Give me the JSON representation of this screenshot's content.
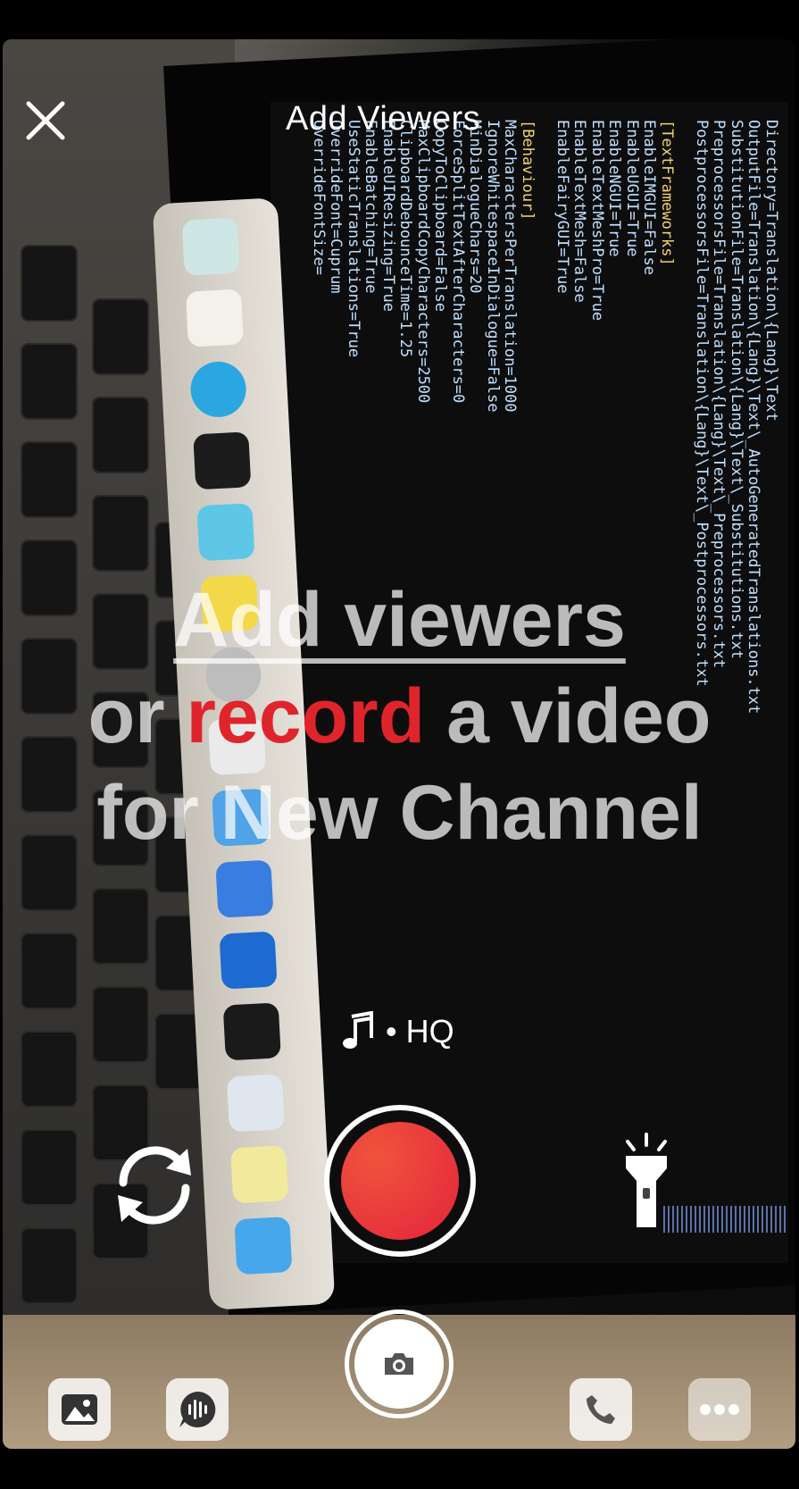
{
  "header": {
    "title": "Add Viewers"
  },
  "prompt": {
    "link_text": "Add viewers",
    "line2_prefix": "or ",
    "line2_accent": "record",
    "line2_suffix": " a video",
    "line3": "for New Channel"
  },
  "status": {
    "quality_label": "• HQ"
  },
  "colors": {
    "accent": "#e0242b",
    "record_button": "#e2243c"
  },
  "icons": {
    "close": "close-icon",
    "music": "music-note-icon",
    "flip": "camera-flip-icon",
    "torch": "flashlight-icon",
    "camera": "camera-icon",
    "gallery": "image-icon",
    "voice": "voice-message-icon",
    "call": "phone-icon",
    "more": "more-icon"
  },
  "background_code": {
    "lines": [
      "Directory=Translation\\{Lang}\\Text",
      "OutputFile=Translation\\{Lang}\\Text\\_AutoGeneratedTranslations.txt",
      "SubstitutionFile=Translation\\{Lang}\\Text\\_Substitutions.txt",
      "PreprocessorsFile=Translation\\{Lang}\\Text\\_Preprocessors.txt",
      "PostprocessorsFile=Translation\\{Lang}\\Text\\_Postprocessors.txt",
      "",
      "[TextFrameworks]",
      "EnableIMGUI=False",
      "EnableUGUI=True",
      "EnableNGUI=True",
      "EnableTextMeshPro=True",
      "EnableTextMesh=False",
      "EnableFairyGUI=True",
      "",
      "[Behaviour]",
      "MaxCharactersPerTranslation=1000",
      "IgnoreWhitespaceInDialogue=False",
      "MinDialogueChars=20",
      "ForceSplitTextAfterCharacters=0",
      "CopyToClipboard=False",
      "MaxClipboardCopyCharacters=2500",
      "ClipboardDebounceTime=1.25",
      "EnableUIResizing=True",
      "EnableBatching=True",
      "UseStaticTranslations=True",
      "OverrideFont=Cuprum",
      "OverrideFontSize="
    ]
  }
}
